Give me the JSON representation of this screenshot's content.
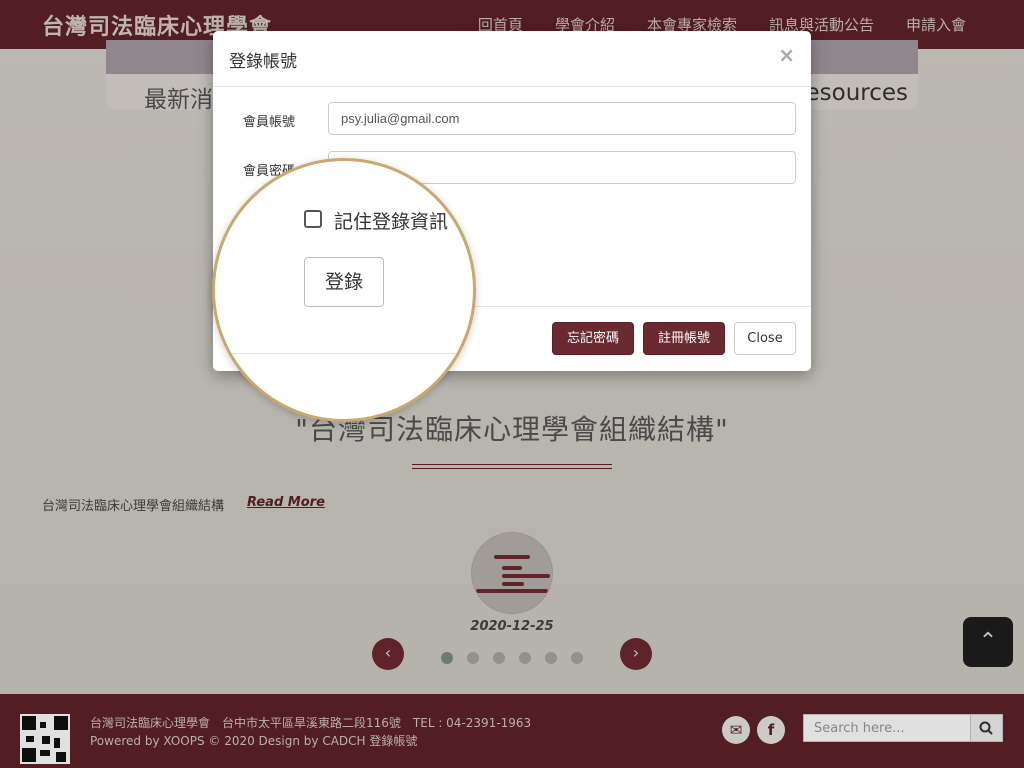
{
  "site": {
    "logo": "台灣司法臨床心理學會",
    "nav": [
      "回首頁",
      "學會介紹",
      "本會專家檢索",
      "訊息與活動公告",
      "申請入會"
    ]
  },
  "banner": {
    "left_text": "最新消",
    "right_text": "esources"
  },
  "section": {
    "title": "\"台灣司法臨床心理學會組織結構\"",
    "excerpt": "台灣司法臨床心理學會組織結構",
    "read_more": "Read More",
    "date": "2020-12-25",
    "prev": "‹",
    "next": "›",
    "dots": 6,
    "active_dot": 0
  },
  "back_to_top": "⌃",
  "footer": {
    "line1": "台灣司法臨床心理學會　台中市太平區旱溪東路二段116號　TEL : 04-2391-1963",
    "line2": "Powered by XOOPS © 2020 Design by CADCH  登錄帳號",
    "search_placeholder": "Search here...",
    "icons": [
      "mail-icon",
      "facebook-icon",
      "search-icon"
    ]
  },
  "modal": {
    "title": "登錄帳號",
    "close_x": "×",
    "account_label": "會員帳號",
    "account_value": "psy.julia@gmail.com",
    "password_label": "會員密碼",
    "password_value": "",
    "remember_label": "記住登錄資訊",
    "login_button": "登錄",
    "forgot_button": "忘記密碼",
    "register_button": "註冊帳號",
    "close_button": "Close"
  },
  "colors": {
    "brand": "#5e2128",
    "button": "#6b2a30",
    "magnifier_ring": "#c9a96e"
  }
}
